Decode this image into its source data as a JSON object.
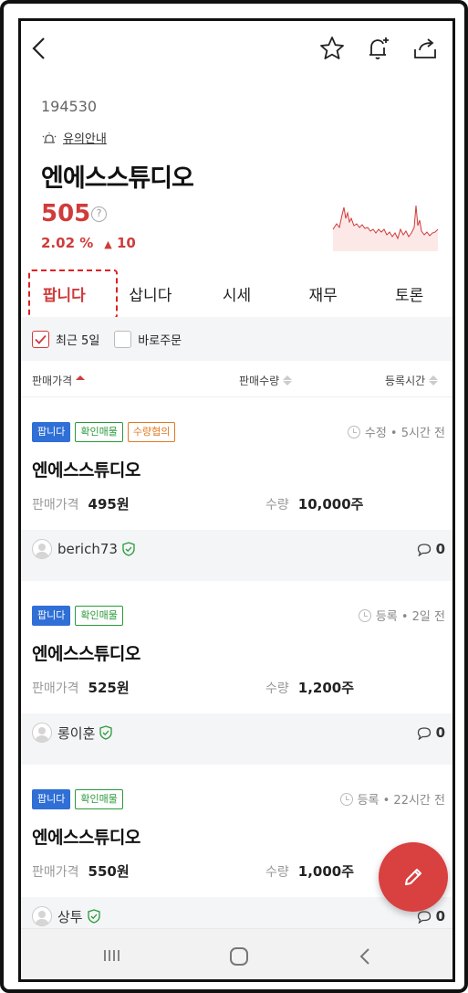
{
  "stock": {
    "code": "194530",
    "notice_label": "유의안내",
    "name": "엔에스스튜디오",
    "price": "505",
    "help_symbol": "?",
    "change_pct": "2.02 %",
    "change_amt": "10",
    "change_arrow": "▲"
  },
  "colors": {
    "accent": "#d03b3b",
    "sell_badge": "#2f6fd6",
    "verified": "#2a9a3a",
    "negotiable": "#e07a20",
    "fab": "#d94040"
  },
  "tabs": [
    {
      "label": "팝니다",
      "active": true
    },
    {
      "label": "삽니다"
    },
    {
      "label": "시세"
    },
    {
      "label": "재무"
    },
    {
      "label": "토론"
    }
  ],
  "filters": {
    "recent5": {
      "label": "최근 5일",
      "checked": true
    },
    "direct": {
      "label": "바로주문",
      "checked": false
    }
  },
  "columns": {
    "price": "판매가격",
    "qty": "판매수량",
    "time": "등록시간"
  },
  "listings": [
    {
      "badges": {
        "sell": "팝니다",
        "verified": "확인매물",
        "negotiable": "수량협의"
      },
      "status": "수정 • 5시간 전",
      "name": "엔에스스튜디오",
      "price_label": "판매가격",
      "price": "495원",
      "qty_label": "수량",
      "qty": "10,000주",
      "user": "berich73",
      "comments": "0"
    },
    {
      "badges": {
        "sell": "팝니다",
        "verified": "확인매물"
      },
      "status": "등록 • 2일 전",
      "name": "엔에스스튜디오",
      "price_label": "판매가격",
      "price": "525원",
      "qty_label": "수량",
      "qty": "1,200주",
      "user": "롱이훈",
      "comments": "0"
    },
    {
      "badges": {
        "sell": "팝니다",
        "verified": "확인매물"
      },
      "status": "등록 • 22시간 전",
      "name": "엔에스스튜디오",
      "price_label": "판매가격",
      "price": "550원",
      "qty_label": "수량",
      "qty": "1,000주",
      "user": "상투",
      "comments": "0"
    }
  ],
  "icons": [
    "back-icon",
    "star-icon",
    "bell-plus-icon",
    "share-icon",
    "alarm-icon",
    "help-icon",
    "clock-icon",
    "shield-check-icon",
    "comment-icon",
    "pencil-icon",
    "recent-apps-icon",
    "home-icon",
    "nav-back-icon"
  ]
}
